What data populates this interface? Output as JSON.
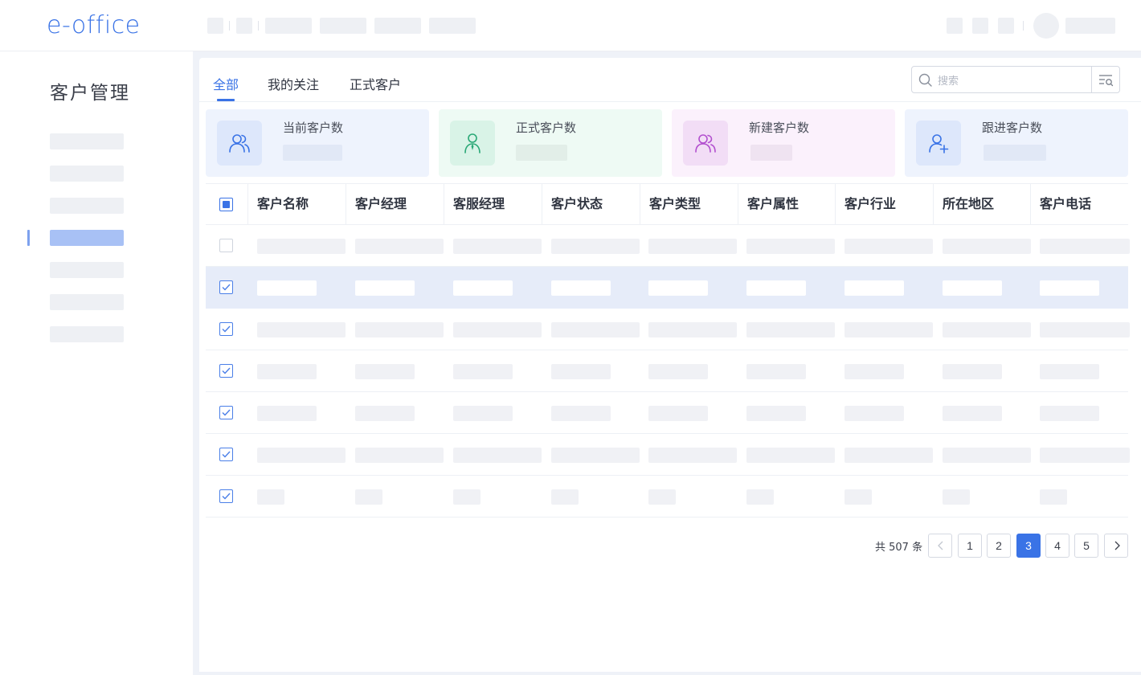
{
  "header": {
    "logo": "e-office"
  },
  "sidebar": {
    "title": "客户管理",
    "active_index": 3
  },
  "tabs": [
    {
      "label": "全部",
      "active": true
    },
    {
      "label": "我的关注",
      "active": false
    },
    {
      "label": "正式客户",
      "active": false
    }
  ],
  "search": {
    "placeholder": "搜索",
    "icon": "search-icon",
    "filter_icon": "filter-search-icon"
  },
  "stats": [
    {
      "label": "当前客户数",
      "icon": "users-icon",
      "color": "#3a73e6",
      "bg": "#eef3fd",
      "icon_bg": "#dde7fb"
    },
    {
      "label": "正式客户数",
      "icon": "user-tie-icon",
      "color": "#2aa876",
      "bg": "#eefaf4",
      "icon_bg": "#d9f3e7"
    },
    {
      "label": "新建客户数",
      "icon": "users-icon",
      "color": "#b24fcf",
      "bg": "#fbf1fc",
      "icon_bg": "#f2ddf6"
    },
    {
      "label": "跟进客户数",
      "icon": "user-add-icon",
      "color": "#3a73e6",
      "bg": "#eef3fd",
      "icon_bg": "#dde7fb"
    }
  ],
  "table": {
    "columns": [
      "客户名称",
      "客户经理",
      "客服经理",
      "客户状态",
      "客户类型",
      "客户属性",
      "客户行业",
      "所在地区",
      "客户电话"
    ],
    "header_checkbox": "partial",
    "rows": [
      {
        "checked": false,
        "selected": false
      },
      {
        "checked": true,
        "selected": true
      },
      {
        "checked": true,
        "selected": false
      },
      {
        "checked": true,
        "selected": false
      },
      {
        "checked": true,
        "selected": false
      },
      {
        "checked": true,
        "selected": false
      },
      {
        "checked": true,
        "selected": false
      }
    ]
  },
  "pagination": {
    "total_text": "共 507 条",
    "pages": [
      "1",
      "2",
      "3",
      "4",
      "5"
    ],
    "current": "3",
    "prev_icon": "chevron-left-icon",
    "next_icon": "chevron-right-icon"
  },
  "colors": {
    "accent": "#3a73e6",
    "selected_row": "#e6ecf9",
    "placeholder": "#f0f1f5"
  }
}
